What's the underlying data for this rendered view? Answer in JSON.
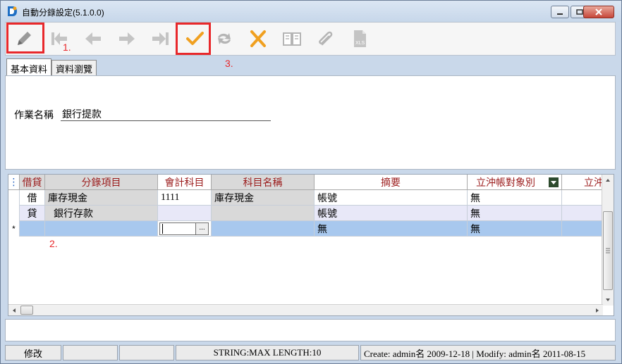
{
  "window": {
    "title": "自動分錄設定(5.1.0.0)"
  },
  "toolbar": {
    "buttons": [
      {
        "icon": "pencil-icon",
        "label": "edit"
      },
      {
        "icon": "first-record-icon"
      },
      {
        "icon": "previous-arrow-icon"
      },
      {
        "icon": "next-arrow-icon"
      },
      {
        "icon": "last-record-icon"
      },
      {
        "icon": "checkmark-icon"
      },
      {
        "icon": "refresh-icon"
      },
      {
        "icon": "cancel-x-icon"
      },
      {
        "icon": "book-icon"
      },
      {
        "icon": "paperclip-icon"
      },
      {
        "icon": "xls-export-icon"
      }
    ]
  },
  "annotations": {
    "step1": "1.",
    "step2": "2.",
    "step3": "3."
  },
  "tabs": [
    {
      "label": "基本資料",
      "active": true
    },
    {
      "label": "資料瀏覽",
      "active": false
    }
  ],
  "form": {
    "job_name_label": "作業名稱",
    "job_name_value": "銀行提款"
  },
  "grid": {
    "columns": [
      "借貸",
      "分錄項目",
      "會計科目",
      "科目名稱",
      "摘要",
      "立沖帳對象別",
      "立沖"
    ],
    "rows": [
      {
        "indicator": "",
        "debit_credit": "借",
        "entry_item": "庫存現金",
        "account_code": "1111",
        "account_name": "庫存現金",
        "summary": "帳號",
        "offset_target": "無"
      },
      {
        "indicator": "",
        "debit_credit": "貸",
        "entry_item": "銀行存款",
        "account_code": "",
        "account_name": "",
        "summary": "帳號",
        "offset_target": "無"
      },
      {
        "indicator": "*",
        "debit_credit": "",
        "entry_item": "",
        "account_code": "",
        "account_name": "",
        "summary": "無",
        "offset_target": "無"
      }
    ],
    "editor_button": "..."
  },
  "status": {
    "mode": "修改",
    "field_info": "STRING:MAX LENGTH:10",
    "audit": "Create: admin名 2009-12-18 | Modify: admin名 2011-08-15"
  },
  "colors": {
    "highlight": "#e8282b",
    "header_text": "#9b1b1b",
    "new_row": "#a8c8ee"
  }
}
